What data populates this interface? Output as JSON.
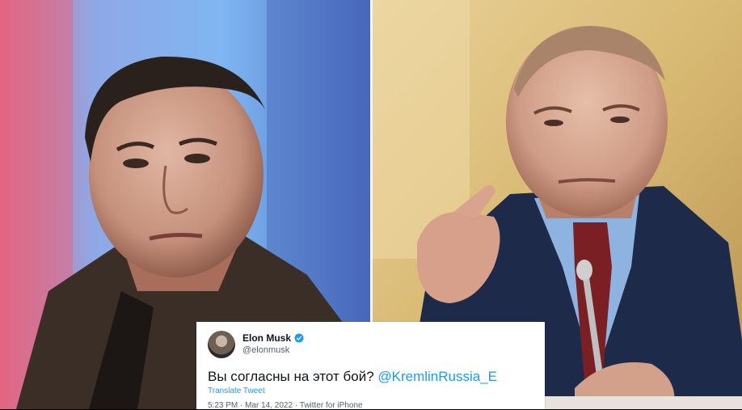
{
  "tweet": {
    "name": "Elon Musk",
    "handle": "@elonmusk",
    "text_plain": "Вы согласны на этот бой? ",
    "text_mention": "@KremlinRussia_E",
    "translate_label": "Translate Tweet",
    "meta": "5:23 PM · Mar 14, 2022 · Twitter for iPhone",
    "verified_icon": "verified-badge-icon",
    "colors": {
      "link": "#1d9bf0",
      "text": "#0f1419",
      "secondary": "#536471"
    }
  }
}
